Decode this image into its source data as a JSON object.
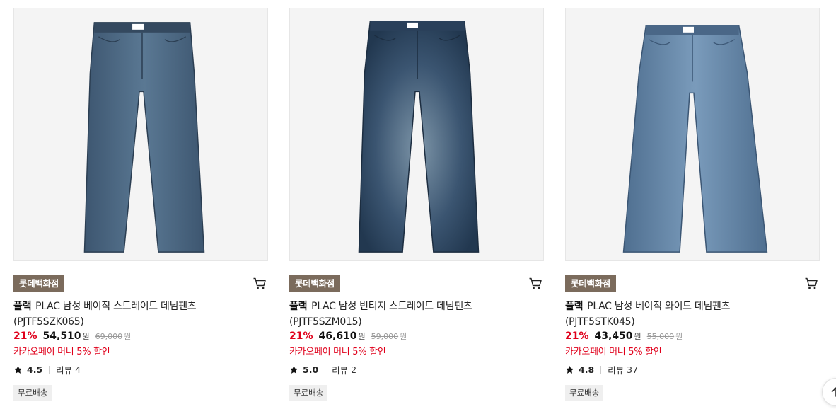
{
  "products": [
    {
      "store": "롯데백화점",
      "brand": "플랙",
      "name": "PLAC 남성 베이직 스트레이트 데님팬츠",
      "code": "(PJTF5SZK065)",
      "discount": "21%",
      "price": "54,510",
      "currency": "원",
      "original_price": "69,000",
      "promo": "카카오페이 머니 5% 할인",
      "rating": "4.5",
      "review_label": "리뷰",
      "review_count": "4",
      "shipping": "무료배송",
      "image_color": "#47627b",
      "image_alt": "PLAC"
    },
    {
      "store": "롯데백화점",
      "brand": "플랙",
      "name": "PLAC 남성 빈티지 스트레이트 데님팬츠",
      "code": "(PJTF5SZM015)",
      "discount": "21%",
      "price": "46,610",
      "currency": "원",
      "original_price": "59,000",
      "promo": "카카오페이 머니 5% 할인",
      "rating": "5.0",
      "review_label": "리뷰",
      "review_count": "2",
      "shipping": "무료배송",
      "image_color": "#2f4660",
      "image_alt": "PLAC"
    },
    {
      "store": "롯데백화점",
      "brand": "플랙",
      "name": "PLAC 남성 베이직 와이드 데님팬츠",
      "code": "(PJTF5STK045)",
      "discount": "21%",
      "price": "43,450",
      "currency": "원",
      "original_price": "55,000",
      "promo": "카카오페이 머니 5% 할인",
      "rating": "4.8",
      "review_label": "리뷰",
      "review_count": "37",
      "shipping": "무료배송",
      "image_color": "#5a7ea3",
      "image_alt": "PLAC"
    }
  ],
  "colors": {
    "discount": "#e0001b",
    "store_badge": "#7b6b5c",
    "shipping_badge": "#efefef"
  },
  "icons": {
    "cart": "cart-icon",
    "star": "star-icon",
    "scroll_top": "arrow-up-icon"
  }
}
